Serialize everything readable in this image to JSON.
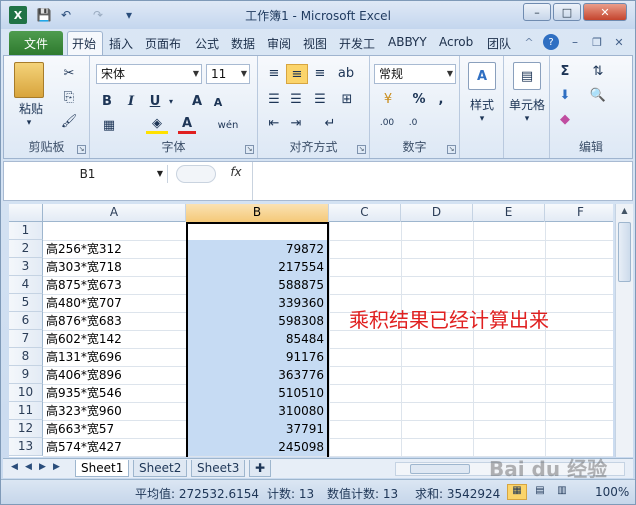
{
  "window": {
    "title": "工作簿1 - Microsoft Excel",
    "controls": {
      "minimize": "–",
      "maximize": "□",
      "close": "✕"
    }
  },
  "qat": {
    "save_icon": "💾",
    "undo_icon": "↶",
    "redo_icon": "↷",
    "more_icon": "▾",
    "excel_icon": "X"
  },
  "tabs": [
    "文件",
    "开始",
    "插入",
    "页面布",
    "公式",
    "数据",
    "审阅",
    "视图",
    "开发工",
    "ABBYY",
    "Acrob",
    "团队"
  ],
  "ribbon": {
    "clipboard": {
      "label": "剪贴板",
      "paste": "粘贴"
    },
    "font": {
      "label": "字体",
      "name": "宋体",
      "size": "11",
      "bold": "B",
      "italic": "I",
      "underline": "U",
      "grow": "A",
      "shrink": "A"
    },
    "alignment": {
      "label": "对齐方式"
    },
    "number": {
      "label": "数字",
      "format": "常规",
      "percent": "%",
      "comma": ","
    },
    "styles": {
      "label": "样式"
    },
    "cells": {
      "label": "单元格"
    },
    "editing": {
      "label": "编辑",
      "sum": "Σ"
    }
  },
  "formula_bar": {
    "name_box": "B1",
    "fx": "fx",
    "content": ""
  },
  "grid": {
    "columns": [
      "A",
      "B",
      "C",
      "D",
      "E",
      "F"
    ],
    "selected_column": "B",
    "rows": [
      {
        "n": "1",
        "a": "",
        "b": ""
      },
      {
        "n": "2",
        "a": "高256*宽312",
        "b": "79872"
      },
      {
        "n": "3",
        "a": "高303*宽718",
        "b": "217554"
      },
      {
        "n": "4",
        "a": "高875*宽673",
        "b": "588875"
      },
      {
        "n": "5",
        "a": "高480*宽707",
        "b": "339360"
      },
      {
        "n": "6",
        "a": "高876*宽683",
        "b": "598308"
      },
      {
        "n": "7",
        "a": "高602*宽142",
        "b": "85484"
      },
      {
        "n": "8",
        "a": "高131*宽696",
        "b": "91176"
      },
      {
        "n": "9",
        "a": "高406*宽896",
        "b": "363776"
      },
      {
        "n": "10",
        "a": "高935*宽546",
        "b": "510510"
      },
      {
        "n": "11",
        "a": "高323*宽960",
        "b": "310080"
      },
      {
        "n": "12",
        "a": "高663*宽57",
        "b": "37791"
      },
      {
        "n": "13",
        "a": "高574*宽427",
        "b": "245098"
      }
    ],
    "annotation": "乘积结果已经计算出来"
  },
  "sheets": [
    "Sheet1",
    "Sheet2",
    "Sheet3"
  ],
  "active_sheet": "Sheet1",
  "status": {
    "average": "平均值: 272532.6154",
    "count": "计数: 13",
    "numeric_count": "数值计数: 13",
    "sum": "求和: 3542924",
    "zoom": "100%"
  },
  "watermark": "Bai du 经验"
}
